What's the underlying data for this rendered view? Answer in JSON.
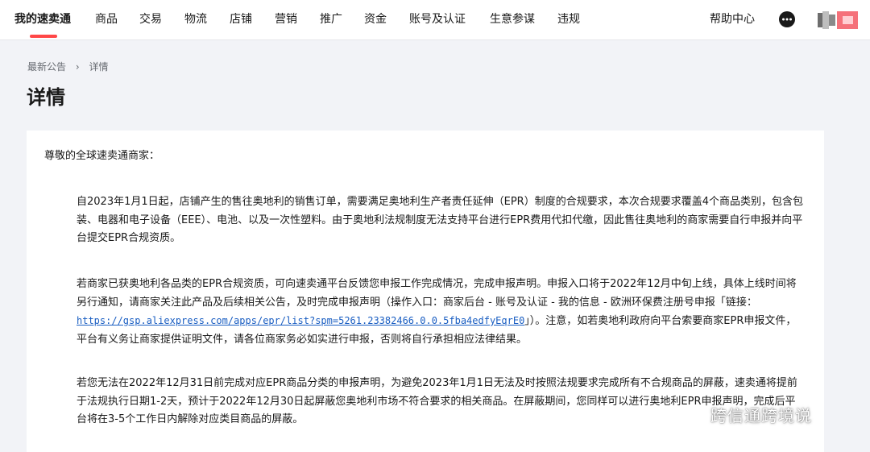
{
  "nav": {
    "items": [
      "我的速卖通",
      "商品",
      "交易",
      "物流",
      "店铺",
      "营销",
      "推广",
      "资金",
      "账号及认证",
      "生意参谋",
      "违规"
    ],
    "help": "帮助中心",
    "message_icon": "chat-bubble-icon",
    "accent_color": "#ff4747"
  },
  "breadcrumb": {
    "parent": "最新公告",
    "current": "详情"
  },
  "page_title": "详情",
  "content": {
    "greeting": "尊敬的全球速卖通商家：",
    "p1": "自2023年1月1日起，店铺产生的售往奥地利的销售订单，需要满足奥地利生产者责任延伸（EPR）制度的合规要求，本次合规要求覆盖4个商品类别，包含包装、电器和电子设备（EEE）、电池、以及一次性塑料。由于奥地利法规制度无法支持平台进行EPR费用代扣代缴，因此售往奥地利的商家需要自行申报并向平台提交EPR合规资质。",
    "p2_before": "若商家已获奥地利各品类的EPR合规资质，可向速卖通平台反馈您申报工作完成情况，完成申报声明。申报入口将于2022年12月中旬上线，具体上线时间将另行通知，请商家关注此产品及后续相关公告，及时完成申报声明（操作入口：商家后台 - 账号及认证 - 我的信息 - 欧洲环保费注册号申报「链接：",
    "p2_link": "https://gsp.aliexpress.com/apps/epr/list?spm=5261.23382466.0.0.5fba4edfyEqrE0",
    "p2_after": "」）。注意，如若奥地利政府向平台索要商家EPR申报文件，平台有义务让商家提供证明文件，请各位商家务必如实进行申报，否则将自行承担相应法律结果。",
    "p3": "若您无法在2022年12月31日前完成对应EPR商品分类的申报声明，为避免2023年1月1日无法及时按照法规要求完成所有不合规商品的屏蔽，速卖通将提前于法规执行日期1-2天，预计于2022年12月30日起屏蔽您奥地利市场不符合要求的相关商品。在屏蔽期间，您同样可以进行奥地利EPR申报声明，完成后平台将在3-5个工作日内解除对应类目商品的屏蔽。"
  },
  "watermark": {
    "text": "跨信通跨境说",
    "icon": "wechat-icon"
  }
}
